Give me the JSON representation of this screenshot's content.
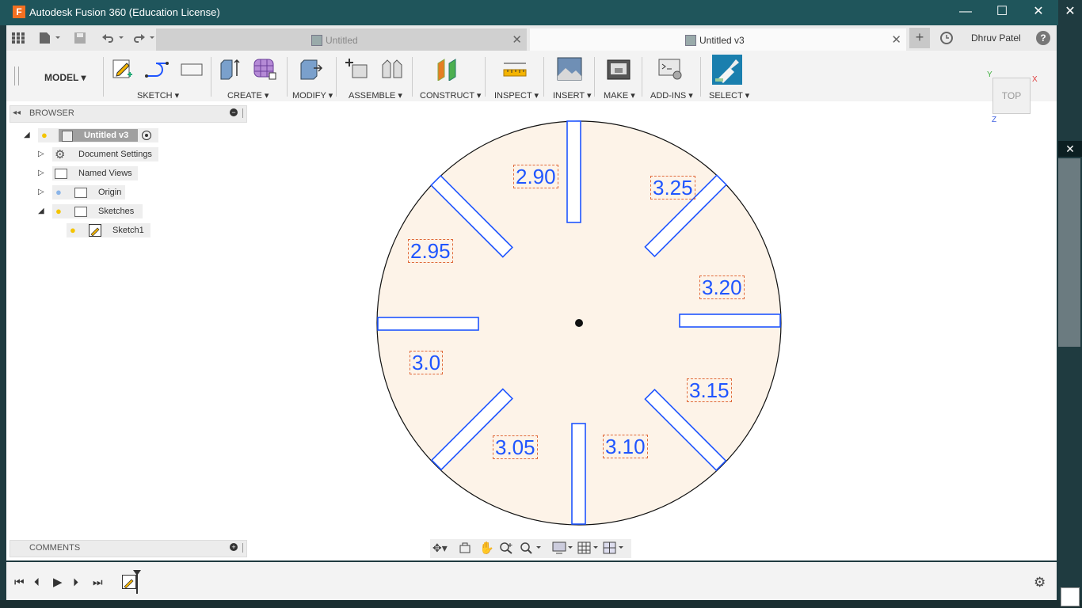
{
  "window": {
    "title": "Autodesk Fusion 360 (Education License)",
    "app_icon_letter": "F",
    "minimize": "—",
    "maximize": "☐",
    "close": "✕"
  },
  "tabs": [
    {
      "label": "Untitled",
      "close": "✕"
    },
    {
      "label": "Untitled v3",
      "close": "✕"
    }
  ],
  "header": {
    "new_tab": "+",
    "user": "Dhruv Patel",
    "help": "?"
  },
  "toolbar": {
    "workspace": "MODEL",
    "groups": [
      "SKETCH",
      "CREATE",
      "MODIFY",
      "ASSEMBLE",
      "CONSTRUCT",
      "INSPECT",
      "INSERT",
      "MAKE",
      "ADD-INS",
      "SELECT"
    ]
  },
  "browser": {
    "title": "BROWSER",
    "root": "Untitled v3",
    "items": [
      "Document Settings",
      "Named Views",
      "Origin",
      "Sketches",
      "Sketch1"
    ]
  },
  "comments": {
    "title": "COMMENTS"
  },
  "viewcube": {
    "face": "TOP",
    "x": "X",
    "y": "Y",
    "z": "Z"
  },
  "sketch": {
    "labels": [
      "2.90",
      "3.25",
      "3.20",
      "3.15",
      "3.10",
      "3.05",
      "3.0",
      "2.95"
    ],
    "colors": {
      "fill": "#fdf3e8",
      "profile": "#1f55ff",
      "outline": "#111111",
      "dim_box": "#e06a3a"
    }
  },
  "icons": {
    "grid": "grid-icon",
    "file": "file-icon",
    "save": "save-icon",
    "undo": "undo-icon",
    "redo": "redo-icon",
    "job_status": "clock-icon",
    "settings": "gear-icon"
  }
}
